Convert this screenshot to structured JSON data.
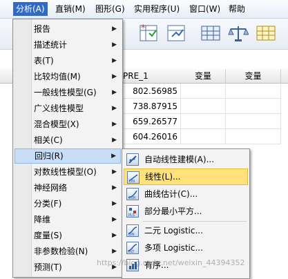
{
  "menubar": {
    "items": [
      {
        "label": "分析(A)",
        "active": true
      },
      {
        "label": "直销(M)",
        "active": false
      },
      {
        "label": "图形(G)",
        "active": false
      },
      {
        "label": "实用程序(U)",
        "active": false
      },
      {
        "label": "窗口(W)",
        "active": false
      },
      {
        "label": "帮助",
        "active": false
      }
    ]
  },
  "grid": {
    "headers": [
      "PRE_1",
      "变量",
      "变量"
    ],
    "pre_values": [
      "802.56985",
      "738.87915",
      "659.26577",
      "604.26016"
    ]
  },
  "analyze_menu": {
    "items": [
      {
        "label": "报告",
        "submenu": true
      },
      {
        "label": "描述统计",
        "submenu": true
      },
      {
        "label": "表(T)",
        "submenu": true
      },
      {
        "label": "比较均值(M)",
        "submenu": true
      },
      {
        "label": "一般线性模型(G)",
        "submenu": true
      },
      {
        "label": "广义线性模型",
        "submenu": true
      },
      {
        "label": "混合模型(X)",
        "submenu": true
      },
      {
        "label": "相关(C)",
        "submenu": true
      },
      {
        "label": "回归(R)",
        "submenu": true,
        "highlighted": true
      },
      {
        "label": "对数线性模型(O)",
        "submenu": true
      },
      {
        "label": "神经网络",
        "submenu": true
      },
      {
        "label": "分类(F)",
        "submenu": true
      },
      {
        "label": "降维",
        "submenu": true
      },
      {
        "label": "度量(S)",
        "submenu": true
      },
      {
        "label": "非参数检验(N)",
        "submenu": true
      },
      {
        "label": "预测(T)",
        "submenu": true
      }
    ]
  },
  "regression_submenu": {
    "items": [
      {
        "label": "自动线性建模(A)...",
        "icon": "auto-linear-icon"
      },
      {
        "label": "线性(L)...",
        "icon": "linear-icon",
        "highlighted": true
      },
      {
        "label": "曲线估计(C)...",
        "icon": "curve-estimation-icon"
      },
      {
        "label": "部分最小平方...",
        "icon": "partial-least-squares-icon"
      },
      {
        "label": "二元 Logistic...",
        "icon": "binary-logistic-icon"
      },
      {
        "label": "多项 Logistic...",
        "icon": "multinomial-logistic-icon"
      },
      {
        "label": "有序...",
        "icon": "ordinal-icon"
      }
    ]
  },
  "watermark": "https://blog.csdn.net/weixin_44394352",
  "colors": {
    "menu_active": "#316ac5",
    "item_highlight": "#c7def6",
    "sub_highlight": "#ffe27a"
  }
}
